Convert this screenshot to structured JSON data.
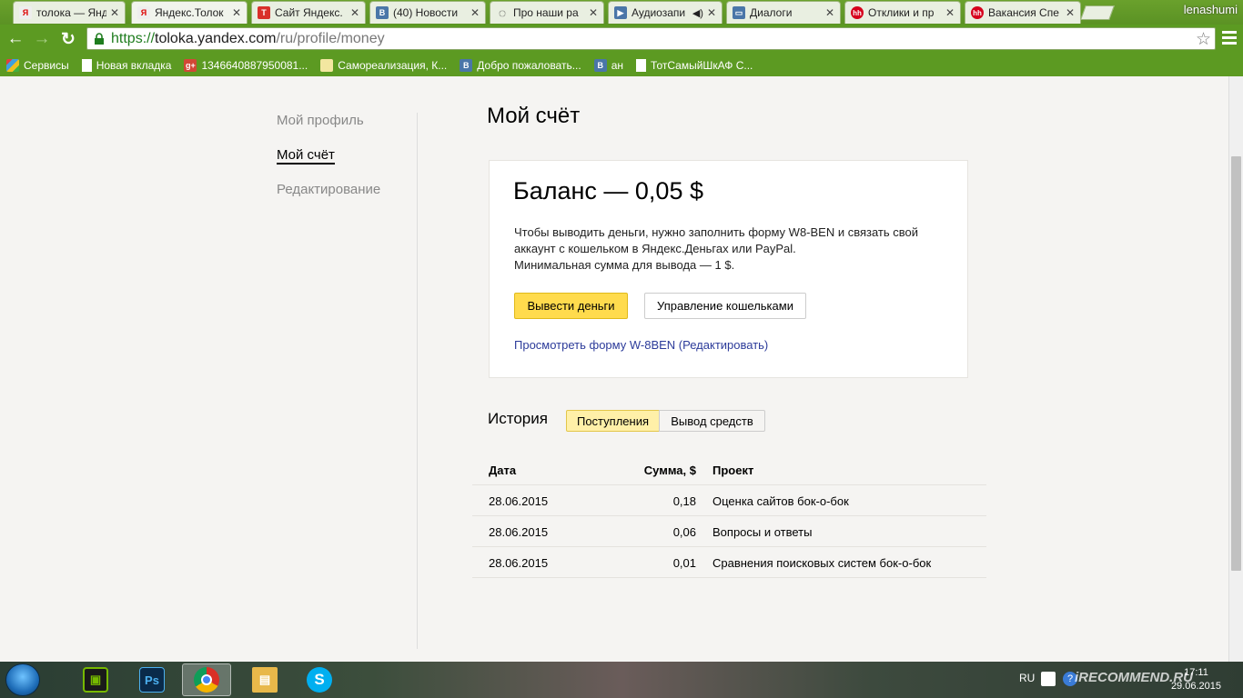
{
  "browser": {
    "tabs": [
      {
        "label": "толока — Янд",
        "favicon": "yandex-icon",
        "color": "#e8e8e8",
        "glyph": "Я"
      },
      {
        "label": "Яндекс.Толок",
        "favicon": "yandex-icon",
        "color": "#e8e8e8",
        "glyph": "Я"
      },
      {
        "label": "Сайт Яндекс.",
        "favicon": "red-t-icon",
        "color": "#d9302a",
        "glyph": "T"
      },
      {
        "label": "(40) Новости",
        "favicon": "vk-icon",
        "color": "#4a76a8",
        "glyph": "B"
      },
      {
        "label": "Про наши ра",
        "favicon": "spinner-icon",
        "color": "#ffffff",
        "glyph": "◌"
      },
      {
        "label": "Аудиозапи",
        "favicon": "play-icon",
        "color": "#4a76a8",
        "glyph": "▶"
      },
      {
        "label": "Диалоги",
        "favicon": "vk-chat-icon",
        "color": "#4a76a8",
        "glyph": "▭"
      },
      {
        "label": "Отклики и пр",
        "favicon": "hh-icon",
        "color": "#d6001c",
        "glyph": "hh"
      },
      {
        "label": "Вакансия Спе",
        "favicon": "hh-icon",
        "color": "#d6001c",
        "glyph": "hh"
      }
    ],
    "user_name": "lenashumi",
    "url_scheme": "https://",
    "url_host": "toloka.yandex.com",
    "url_path": "/ru/profile/money",
    "bookmarks": [
      {
        "label": "Сервисы",
        "icon": "apps-grid-icon",
        "color": "#e0b020",
        "glyph": "⋮"
      },
      {
        "label": "Новая вкладка",
        "icon": "page-icon",
        "color": "#ffffff",
        "glyph": ""
      },
      {
        "label": "1346640887950081...",
        "icon": "google-plus-icon",
        "color": "#d14836",
        "glyph": "g+"
      },
      {
        "label": "Самореализация, К...",
        "icon": "site-icon",
        "color": "#f3e7a0",
        "glyph": ""
      },
      {
        "label": "Добро пожаловать...",
        "icon": "vk-icon",
        "color": "#4a76a8",
        "glyph": "B"
      },
      {
        "label": "ан",
        "icon": "vk-icon",
        "color": "#4a76a8",
        "glyph": "B"
      },
      {
        "label": "ТотСамыйШкАФ С...",
        "icon": "page-icon",
        "color": "#ffffff",
        "glyph": ""
      }
    ]
  },
  "sidebar": {
    "items": [
      {
        "label": "Мой профиль"
      },
      {
        "label": "Мой счёт"
      },
      {
        "label": "Редактирование"
      }
    ]
  },
  "main": {
    "title": "Мой счёт",
    "balance": "Баланс — 0,05 $",
    "info_line1": "Чтобы выводить деньги, нужно заполнить форму W8-BEN и связать свой",
    "info_line2": "аккаунт с кошельком в Яндекс.Деньгах или PayPal.",
    "info_line3": "Минимальная сумма для вывода — 1 $.",
    "withdraw_button": "Вывести деньги",
    "wallets_button": "Управление кошельками",
    "w8_link": "Просмотреть форму W-8BEN (Редактировать)"
  },
  "history": {
    "title": "История",
    "tab_income": "Поступления",
    "tab_withdraw": "Вывод средств",
    "columns": {
      "date": "Дата",
      "sum": "Сумма, $",
      "project": "Проект"
    },
    "rows": [
      {
        "date": "28.06.2015",
        "sum": "0,18",
        "project": "Оценка сайтов бок-о-бок"
      },
      {
        "date": "28.06.2015",
        "sum": "0,06",
        "project": "Вопросы и ответы"
      },
      {
        "date": "28.06.2015",
        "sum": "0,01",
        "project": "Сравнения поисковых систем бок-о-бок"
      }
    ]
  },
  "taskbar": {
    "lang": "RU",
    "time": "17:11",
    "date": "29.06.2015",
    "watermark": "iRECOMMEND.RU",
    "apps": [
      {
        "name": "nvidia-icon",
        "color": "#76b900",
        "glyph": "▣"
      },
      {
        "name": "photoshop-icon",
        "color": "#0a2a4a",
        "glyph": "Ps"
      },
      {
        "name": "chrome-icon",
        "color": "#d93025",
        "glyph": "◉"
      },
      {
        "name": "explorer-icon",
        "color": "#e8b84a",
        "glyph": "▤"
      },
      {
        "name": "skype-icon",
        "color": "#00aff0",
        "glyph": "S"
      }
    ]
  }
}
